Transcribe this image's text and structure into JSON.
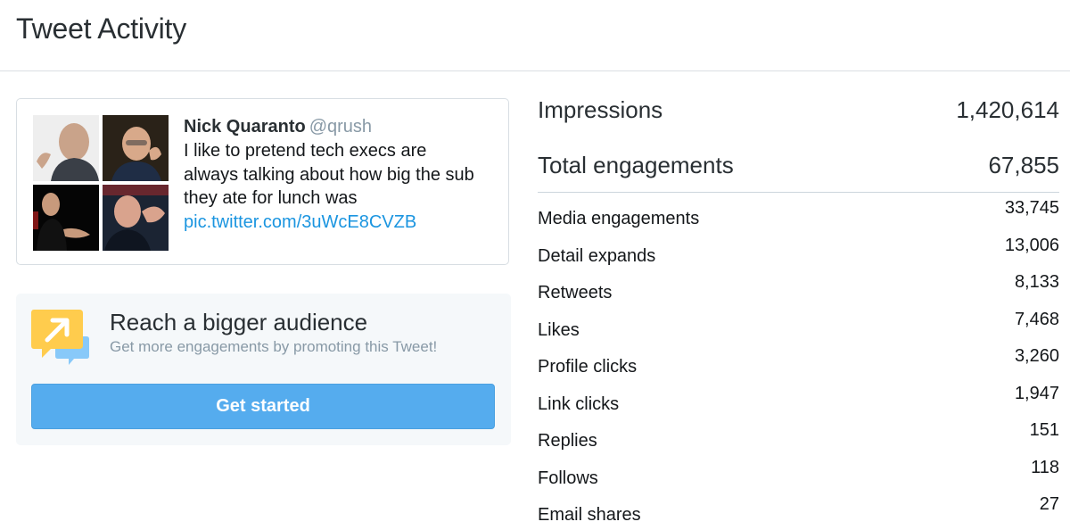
{
  "header": {
    "title": "Tweet Activity"
  },
  "tweet": {
    "author_name": "Nick Quaranto",
    "author_handle": "@qrush",
    "text_lines": [
      "I like to pretend tech execs are",
      "always talking about how big the sub",
      "they ate for lunch was"
    ],
    "link": "pic.twitter.com/3uWcE8CVZB"
  },
  "promo": {
    "title": "Reach a bigger audience",
    "subtitle": "Get more engagements by promoting this Tweet!",
    "button_label": "Get started",
    "icon": "promote-arrow-icon",
    "colors": {
      "button": "#55acee",
      "icon_bubble": "#ffcc4d",
      "icon_bubble_back": "#88c9f9"
    }
  },
  "metrics": {
    "impressions": {
      "label": "Impressions",
      "value": "1,420,614"
    },
    "total_engagements": {
      "label": "Total engagements",
      "value": "67,855"
    },
    "rows": [
      {
        "label": "Media engagements",
        "value": "33,745"
      },
      {
        "label": "Detail expands",
        "value": "13,006"
      },
      {
        "label": "Retweets",
        "value": "8,133"
      },
      {
        "label": "Likes",
        "value": "7,468"
      },
      {
        "label": "Profile clicks",
        "value": "3,260"
      },
      {
        "label": "Link clicks",
        "value": "1,947"
      },
      {
        "label": "Replies",
        "value": "151"
      },
      {
        "label": "Follows",
        "value": "118"
      },
      {
        "label": "Email shares",
        "value": "27"
      }
    ]
  }
}
